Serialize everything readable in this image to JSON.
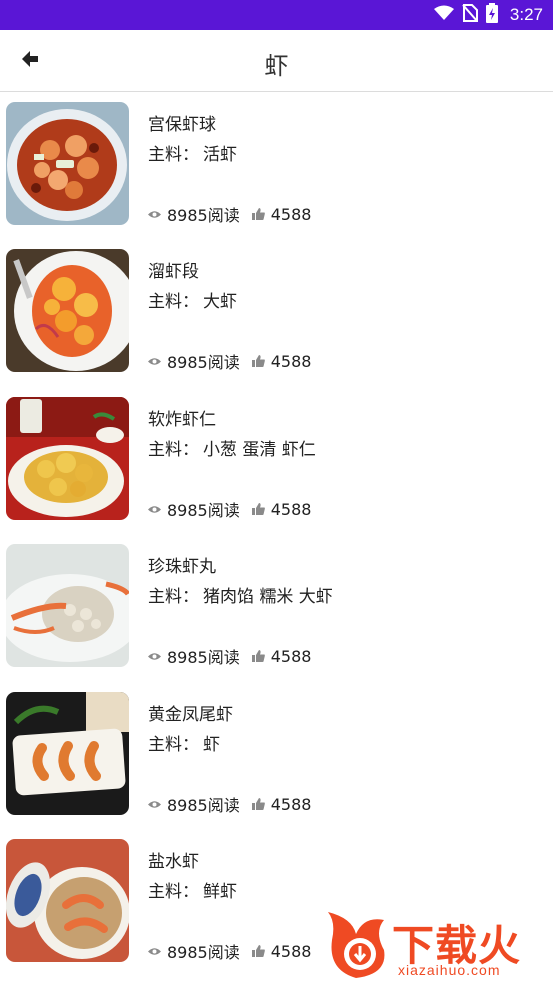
{
  "status_bar": {
    "time": "3:27"
  },
  "header": {
    "title": "虾"
  },
  "ingredients_label": "主料：",
  "recipes": [
    {
      "name": "宫保虾球",
      "ingredients": "活虾",
      "reads": "8985阅读",
      "likes": "4588"
    },
    {
      "name": "溜虾段",
      "ingredients": "大虾",
      "reads": "8985阅读",
      "likes": "4588"
    },
    {
      "name": "软炸虾仁",
      "ingredients": "小葱 蛋清 虾仁",
      "reads": "8985阅读",
      "likes": "4588"
    },
    {
      "name": "珍珠虾丸",
      "ingredients": "猪肉馅 糯米 大虾",
      "reads": "8985阅读",
      "likes": "4588"
    },
    {
      "name": "黄金凤尾虾",
      "ingredients": "虾",
      "reads": "8985阅读",
      "likes": "4588"
    },
    {
      "name": "盐水虾",
      "ingredients": "鲜虾",
      "reads": "8985阅读",
      "likes": "4588"
    }
  ],
  "watermark": {
    "brand": "下载火",
    "url": "xiazaihuo.com"
  },
  "colors": {
    "status_bar": "#5a16d6",
    "watermark": "#ef4a23",
    "icon_gray": "#8a8a8a"
  }
}
